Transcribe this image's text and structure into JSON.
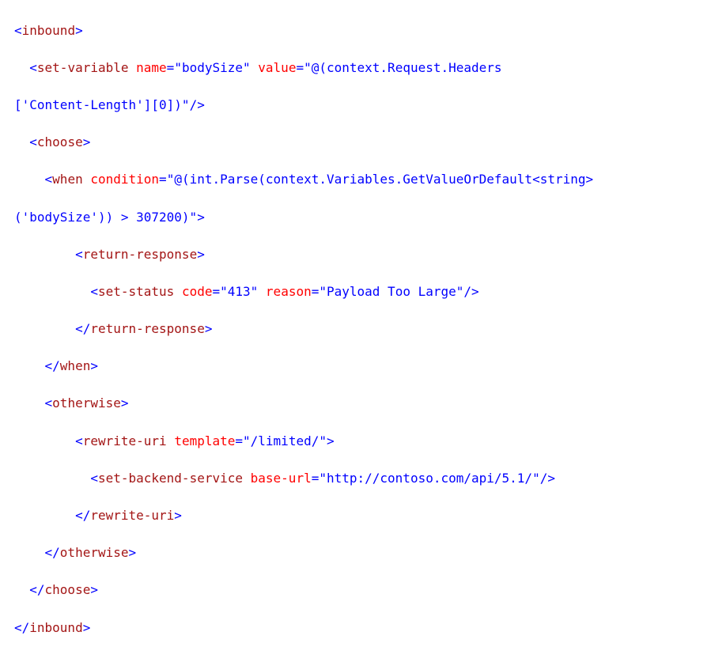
{
  "code": {
    "tags": {
      "inbound": "inbound",
      "set_variable": "set-variable",
      "choose": "choose",
      "when": "when",
      "return_response": "return-response",
      "set_status": "set-status",
      "otherwise": "otherwise",
      "rewrite_uri": "rewrite-uri",
      "set_backend_service": "set-backend-service"
    },
    "attrs": {
      "name": "name",
      "value": "value",
      "condition": "condition",
      "code": "code",
      "reason": "reason",
      "template": "template",
      "base_url": "base-url"
    },
    "values": {
      "body_size_name": "\"bodySize\"",
      "value_part1": "\"@(context.Request.Headers",
      "value_part2": "['Content-Length'][0])\"",
      "condition_part1": "\"@(int.Parse(context.Variables.GetValueOrDefault<string>",
      "condition_part2": "('bodySize')) > 307200)\"",
      "status_code": "\"413\"",
      "status_reason": "\"Payload Too Large\"",
      "template": "\"/limited/\"",
      "base_url": "\"http://contoso.com/api/5.1/\""
    }
  }
}
